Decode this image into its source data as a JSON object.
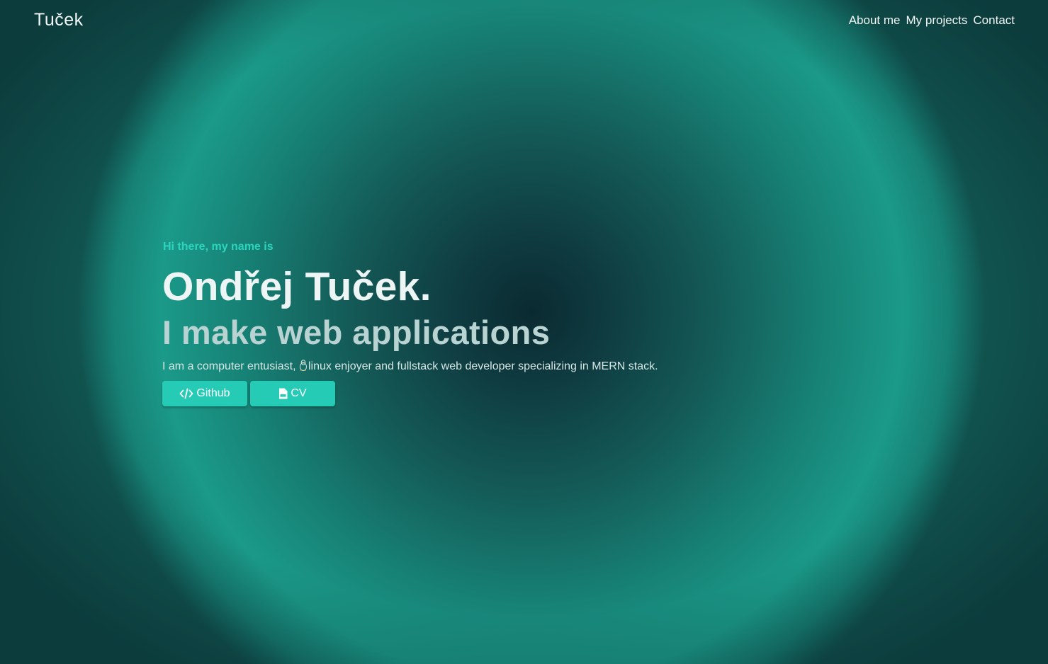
{
  "nav": {
    "brand": "Tuček",
    "links": [
      {
        "label": "About me"
      },
      {
        "label": "My projects"
      },
      {
        "label": "Contact"
      }
    ]
  },
  "hero": {
    "greeting": "Hi there, my name is",
    "name": "Ondřej Tuček.",
    "tagline": "I make web applications",
    "description_before_icon": "I am a computer entusiast, ",
    "description_icon": "linux-tux-icon",
    "description_after_icon": "linux enjoyer and fullstack web developer specializing in MERN stack.",
    "buttons": [
      {
        "label": "Github",
        "icon": "code-icon"
      },
      {
        "label": "CV",
        "icon": "pdf-file-icon"
      }
    ]
  },
  "colors": {
    "accent": "#26cbb6",
    "greeting": "#2bd4bd",
    "background_dark": "#0a2a30",
    "background_ring": "#1b9a89"
  }
}
